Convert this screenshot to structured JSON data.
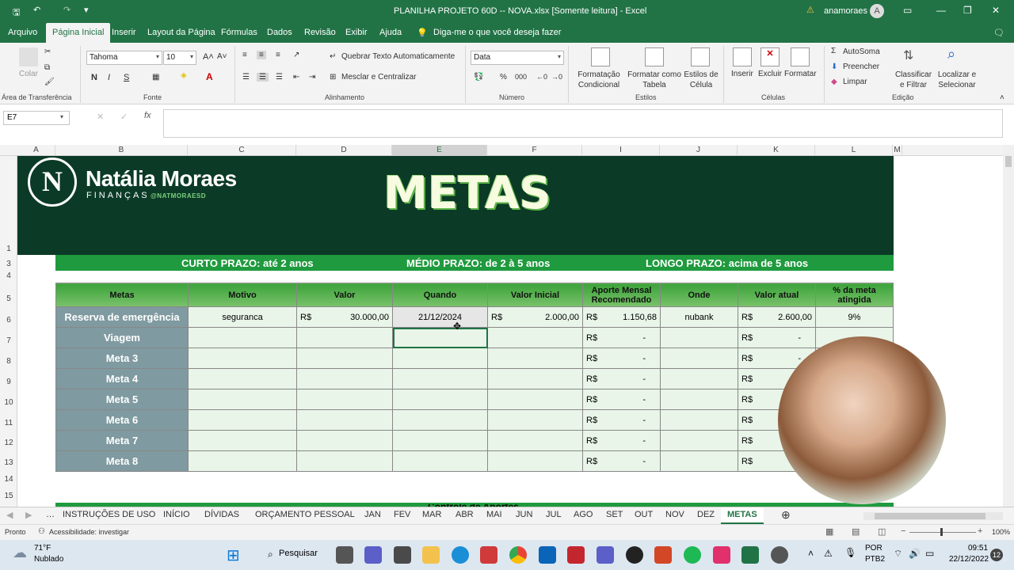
{
  "window": {
    "title": "PLANILHA PROJETO 60D -- NOVA.xlsx  [Somente leitura]  -  Excel",
    "user": "anamoraes",
    "avatar_initial": "A",
    "warning_icon": "warning-icon"
  },
  "menu": [
    "Arquivo",
    "Página Inicial",
    "Inserir",
    "Layout da Página",
    "Fórmulas",
    "Dados",
    "Revisão",
    "Exibir",
    "Ajuda"
  ],
  "tellme": "Diga-me o que você deseja fazer",
  "ribbon": {
    "paste": "Colar",
    "clipboard_label": "Área de Transferência",
    "font_name": "Tahoma",
    "font_size": "10",
    "font_label": "Fonte",
    "bold": "N",
    "italic": "I",
    "underline": "S",
    "wrap": "Quebrar Texto Automaticamente",
    "merge": "Mesclar e Centralizar",
    "align_label": "Alinhamento",
    "number_format": "Data",
    "number_label": "Número",
    "cond_fmt": "Formatação Condicional",
    "fmt_table": "Formatar como Tabela",
    "cell_styles": "Estilos de Célula",
    "styles_label": "Estilos",
    "insert": "Inserir",
    "delete": "Excluir",
    "format": "Formatar",
    "cells_label": "Células",
    "autosum": "AutoSoma",
    "fill": "Preencher",
    "clear": "Limpar",
    "sort": "Classificar e Filtrar",
    "find": "Localizar e Selecionar",
    "edit_label": "Edição"
  },
  "namebox": "E7",
  "columns": [
    "A",
    "B",
    "C",
    "D",
    "E",
    "F",
    "I",
    "J",
    "K",
    "L",
    "M"
  ],
  "rows": [
    "1",
    "3",
    "4",
    "5",
    "6",
    "7",
    "8",
    "9",
    "10",
    "11",
    "12",
    "13",
    "14",
    "15"
  ],
  "banner": {
    "logo": "N",
    "brand": "Natália Moraes",
    "sub": "FINANÇAS",
    "handle": "@NATMORAESD",
    "title": "METAS"
  },
  "horizons": [
    "CURTO PRAZO: até 2 anos",
    "MÉDIO PRAZO: de 2 à 5 anos",
    "LONGO PRAZO: acima de 5 anos"
  ],
  "table": {
    "headers": [
      "Metas",
      "Motivo",
      "Valor",
      "Quando",
      "Valor Inicial",
      "Aporte Mensal Recomendado",
      "Onde",
      "Valor atual",
      "% da meta atingida"
    ],
    "currency": "R$",
    "first_row": {
      "meta": "Reserva de emergência",
      "motivo": "seguranca",
      "valor": "30.000,00",
      "quando": "21/12/2024",
      "inicial": "2.000,00",
      "aporte": "1.150,68",
      "onde": "nubank",
      "atual": "2.600,00",
      "pct": "9%"
    },
    "other_metas": [
      "Viagem",
      "Meta 3",
      "Meta 4",
      "Meta 5",
      "Meta 6",
      "Meta 7",
      "Meta 8"
    ],
    "dash": "-"
  },
  "sheet_tabs": [
    "INSTRUÇÕES DE USO",
    "INÍCIO",
    "DÍVIDAS",
    "ORÇAMENTO PESSOAL",
    "JAN",
    "FEV",
    "MAR",
    "ABR",
    "MAI",
    "JUN",
    "JUL",
    "AGO",
    "SET",
    "OUT",
    "NOV",
    "DEZ",
    "METAS"
  ],
  "footer_partial": "Controle de Aportes",
  "status": {
    "ready": "Pronto",
    "accessibility": "Acessibilidade: investigar",
    "zoom": "100%"
  },
  "taskbar": {
    "temp": "71°F",
    "weather": "Nublado",
    "search": "Pesquisar",
    "lang1": "POR",
    "lang2": "PTB2",
    "time": "09:51",
    "date": "22/12/2022",
    "notif": "12"
  }
}
